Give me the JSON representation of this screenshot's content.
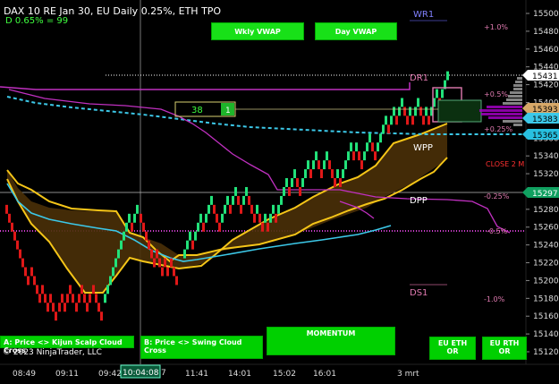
{
  "header": {
    "title": "DAX 10  RE Jan 30, EU Daily 0.25%, ETH TPO",
    "subtitle": "D 0.65% = 99"
  },
  "buttons": {
    "wkly_vwap": "Wkly VWAP",
    "day_vwap": "Day VWAP",
    "kijun": "A: Price <> Kijun Scalp Cloud Cross",
    "swing": "B: Price <> Swing Cloud Cross",
    "momentum": "MOMENTUM",
    "eu_eth": "EU ETH OR",
    "eu_rth": "EU RTH OR"
  },
  "copyright": "© 2023 NinjaTrader, LLC",
  "price_axis": [
    "15500",
    "15480",
    "15460",
    "15440",
    "15420",
    "15400",
    "15380",
    "15360",
    "15340",
    "15320",
    "15300",
    "15280",
    "15260",
    "15240",
    "15220",
    "15200",
    "15180",
    "15160",
    "15140",
    "15120"
  ],
  "time_axis": [
    "08:49",
    "09:11",
    "09:42",
    "11:41",
    "14:01",
    "15:02",
    "16:01",
    "3 mrt"
  ],
  "crosshair_time": "10:04:08",
  "crosshair_time_fragment": "7",
  "price_tags": {
    "current": "15431",
    "vwap_a": "15393",
    "vwap_b": "15383",
    "cyan": "15365",
    "dpp": "15297"
  },
  "levels": {
    "wr1": "WR1",
    "dr1": "DR1",
    "wpp": "WPP",
    "dpp": "DPP",
    "ds1": "DS1",
    "close": "CLOSE 2 M"
  },
  "pct_labels": {
    "p1": "+1.0%",
    "p05": "+0.5%",
    "p025": "+0.25%",
    "m025": "-0.25%",
    "m05": "-0.5%",
    "m1": "-1.0%"
  },
  "box": {
    "value": "38",
    "marker": "1"
  },
  "colors": {
    "bull": "#22e27a",
    "bear": "#e01818",
    "cloud_line": "#f5c518",
    "cyan": "#3cc8e8",
    "magenta": "#c030c0",
    "axis_green": "#00c060"
  },
  "chart_data": {
    "type": "renko",
    "ylim": [
      15110,
      15510
    ],
    "x_labels": [
      "08:49",
      "09:11",
      "09:42",
      "11:41",
      "14:01",
      "15:02",
      "16:01",
      "3 mrt"
    ],
    "bricks": [
      [
        6,
        15280,
        "d"
      ],
      [
        9,
        15270,
        "d"
      ],
      [
        12,
        15260,
        "d"
      ],
      [
        15,
        15250,
        "d"
      ],
      [
        18,
        15240,
        "d"
      ],
      [
        21,
        15230,
        "d"
      ],
      [
        24,
        15220,
        "d"
      ],
      [
        27,
        15210,
        "d"
      ],
      [
        30,
        15200,
        "d"
      ],
      [
        34,
        15210,
        "d"
      ],
      [
        37,
        15200,
        "d"
      ],
      [
        40,
        15190,
        "d"
      ],
      [
        43,
        15180,
        "d"
      ],
      [
        46,
        15190,
        "d"
      ],
      [
        49,
        15180,
        "d"
      ],
      [
        52,
        15170,
        "d"
      ],
      [
        55,
        15180,
        "d"
      ],
      [
        58,
        15170,
        "d"
      ],
      [
        61,
        15160,
        "d"
      ],
      [
        65,
        15170,
        "d"
      ],
      [
        68,
        15180,
        "d"
      ],
      [
        71,
        15170,
        "d"
      ],
      [
        74,
        15180,
        "d"
      ],
      [
        77,
        15190,
        "d"
      ],
      [
        80,
        15180,
        "d"
      ],
      [
        84,
        15170,
        "d"
      ],
      [
        87,
        15180,
        "d"
      ],
      [
        90,
        15190,
        "d"
      ],
      [
        93,
        15180,
        "d"
      ],
      [
        96,
        15170,
        "d"
      ],
      [
        99,
        15180,
        "d"
      ],
      [
        103,
        15190,
        "d"
      ],
      [
        106,
        15180,
        "d"
      ],
      [
        109,
        15170,
        "d"
      ],
      [
        112,
        15160,
        "d"
      ],
      [
        116,
        15180,
        "u"
      ],
      [
        119,
        15190,
        "u"
      ],
      [
        122,
        15200,
        "u"
      ],
      [
        125,
        15210,
        "u"
      ],
      [
        128,
        15220,
        "u"
      ],
      [
        131,
        15230,
        "u"
      ],
      [
        134,
        15240,
        "u"
      ],
      [
        137,
        15250,
        "u"
      ],
      [
        140,
        15260,
        "u"
      ],
      [
        143,
        15270,
        "u"
      ],
      [
        146,
        15260,
        "d"
      ],
      [
        149,
        15270,
        "u"
      ],
      [
        152,
        15280,
        "u"
      ],
      [
        156,
        15270,
        "d"
      ],
      [
        159,
        15260,
        "d"
      ],
      [
        162,
        15250,
        "d"
      ],
      [
        165,
        15240,
        "d"
      ],
      [
        168,
        15230,
        "d"
      ],
      [
        171,
        15220,
        "d"
      ],
      [
        174,
        15230,
        "d"
      ],
      [
        177,
        15220,
        "d"
      ],
      [
        180,
        15210,
        "d"
      ],
      [
        183,
        15220,
        "d"
      ],
      [
        186,
        15210,
        "d"
      ],
      [
        190,
        15220,
        "d"
      ],
      [
        193,
        15210,
        "d"
      ],
      [
        196,
        15200,
        "d"
      ],
      [
        205,
        15230,
        "u"
      ],
      [
        208,
        15240,
        "u"
      ],
      [
        211,
        15250,
        "u"
      ],
      [
        214,
        15240,
        "d"
      ],
      [
        217,
        15250,
        "u"
      ],
      [
        220,
        15260,
        "u"
      ],
      [
        223,
        15270,
        "u"
      ],
      [
        226,
        15260,
        "d"
      ],
      [
        229,
        15270,
        "u"
      ],
      [
        232,
        15280,
        "u"
      ],
      [
        235,
        15290,
        "u"
      ],
      [
        238,
        15280,
        "d"
      ],
      [
        241,
        15270,
        "d"
      ],
      [
        244,
        15260,
        "d"
      ],
      [
        247,
        15270,
        "u"
      ],
      [
        250,
        15280,
        "u"
      ],
      [
        253,
        15290,
        "u"
      ],
      [
        256,
        15280,
        "d"
      ],
      [
        259,
        15290,
        "u"
      ],
      [
        262,
        15300,
        "u"
      ],
      [
        265,
        15290,
        "d"
      ],
      [
        268,
        15280,
        "d"
      ],
      [
        271,
        15290,
        "u"
      ],
      [
        274,
        15300,
        "u"
      ],
      [
        277,
        15290,
        "d"
      ],
      [
        280,
        15280,
        "d"
      ],
      [
        283,
        15270,
        "d"
      ],
      [
        286,
        15280,
        "u"
      ],
      [
        289,
        15270,
        "d"
      ],
      [
        292,
        15260,
        "d"
      ],
      [
        295,
        15270,
        "u"
      ],
      [
        298,
        15260,
        "d"
      ],
      [
        301,
        15270,
        "u"
      ],
      [
        304,
        15280,
        "u"
      ],
      [
        307,
        15270,
        "d"
      ],
      [
        310,
        15280,
        "u"
      ],
      [
        313,
        15290,
        "u"
      ],
      [
        316,
        15300,
        "u"
      ],
      [
        319,
        15310,
        "u"
      ],
      [
        322,
        15300,
        "d"
      ],
      [
        325,
        15310,
        "u"
      ],
      [
        328,
        15320,
        "u"
      ],
      [
        331,
        15310,
        "d"
      ],
      [
        334,
        15300,
        "d"
      ],
      [
        337,
        15310,
        "u"
      ],
      [
        340,
        15320,
        "u"
      ],
      [
        343,
        15330,
        "u"
      ],
      [
        346,
        15320,
        "d"
      ],
      [
        349,
        15330,
        "u"
      ],
      [
        352,
        15340,
        "u"
      ],
      [
        355,
        15330,
        "d"
      ],
      [
        358,
        15320,
        "d"
      ],
      [
        361,
        15330,
        "u"
      ],
      [
        364,
        15340,
        "u"
      ],
      [
        367,
        15330,
        "d"
      ],
      [
        370,
        15320,
        "d"
      ],
      [
        373,
        15310,
        "d"
      ],
      [
        376,
        15320,
        "u"
      ],
      [
        379,
        15310,
        "d"
      ],
      [
        382,
        15320,
        "u"
      ],
      [
        385,
        15330,
        "u"
      ],
      [
        388,
        15340,
        "u"
      ],
      [
        391,
        15350,
        "u"
      ],
      [
        394,
        15340,
        "d"
      ],
      [
        397,
        15350,
        "u"
      ],
      [
        400,
        15340,
        "d"
      ],
      [
        403,
        15330,
        "d"
      ],
      [
        406,
        15340,
        "u"
      ],
      [
        409,
        15350,
        "u"
      ],
      [
        412,
        15360,
        "u"
      ],
      [
        415,
        15350,
        "d"
      ],
      [
        418,
        15340,
        "d"
      ],
      [
        421,
        15350,
        "u"
      ],
      [
        424,
        15360,
        "u"
      ],
      [
        427,
        15370,
        "u"
      ],
      [
        430,
        15380,
        "u"
      ],
      [
        433,
        15370,
        "d"
      ],
      [
        436,
        15380,
        "u"
      ],
      [
        439,
        15390,
        "u"
      ],
      [
        442,
        15380,
        "d"
      ],
      [
        445,
        15390,
        "u"
      ],
      [
        448,
        15400,
        "u"
      ],
      [
        451,
        15390,
        "d"
      ],
      [
        454,
        15380,
        "d"
      ],
      [
        457,
        15390,
        "u"
      ],
      [
        460,
        15380,
        "d"
      ],
      [
        463,
        15390,
        "u"
      ],
      [
        466,
        15400,
        "u"
      ],
      [
        469,
        15390,
        "d"
      ],
      [
        472,
        15380,
        "d"
      ],
      [
        475,
        15390,
        "u"
      ],
      [
        478,
        15380,
        "d"
      ],
      [
        481,
        15390,
        "u"
      ],
      [
        484,
        15400,
        "u"
      ],
      [
        487,
        15410,
        "u"
      ],
      [
        490,
        15400,
        "d"
      ],
      [
        493,
        15410,
        "u"
      ],
      [
        496,
        15420,
        "u"
      ],
      [
        499,
        15430,
        "u"
      ]
    ]
  }
}
